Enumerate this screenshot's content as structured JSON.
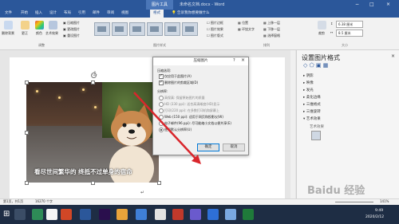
{
  "window": {
    "title": "未命名文档.docx - Word",
    "tools_tab": "图片工具",
    "controls": [
      "−",
      "□",
      "×"
    ]
  },
  "tabs": [
    "文件",
    "开始",
    "插入",
    "设计",
    "布局",
    "引用",
    "邮件",
    "审阅",
    "视图",
    "格式"
  ],
  "tell_me": "告诉我你想要做什么",
  "ribbon": {
    "adjust_buttons": [
      "删除背景",
      "更正",
      "颜色",
      "艺术效果"
    ],
    "adjust_small": [
      "压缩图片",
      "更改图片",
      "重设图片"
    ],
    "adjust_group": "调整",
    "styles_group": "图片样式",
    "style_options": [
      "图片边框",
      "图片效果",
      "图片版式"
    ],
    "arrange": [
      "位置",
      "环绕文字",
      "上移一层",
      "下移一层",
      "选择窗格"
    ],
    "arrange_group": "排列",
    "size_group": "大小",
    "crop": "裁剪",
    "height": "6.38 厘米",
    "width": "8.5 厘米"
  },
  "image": {
    "caption": "看尽世间繁华的 终抵不过单身的宿命"
  },
  "dialog": {
    "title": "压缩图片",
    "section1": "压缩选项:",
    "options": [
      {
        "label": "仅应用于此图片(A)",
        "checked": true
      },
      {
        "label": "删除图片的剪裁区域(D)",
        "checked": true
      }
    ],
    "section2": "分辨率:",
    "resolutions": [
      {
        "label": "高保真: 保留原始图片的质量",
        "enabled": false,
        "selected": false
      },
      {
        "label": "HD (330 ppi): 适合高清晰度(HD)显示",
        "enabled": false,
        "selected": false
      },
      {
        "label": "打印(220 ppi): 在多数打印机和屏幕上",
        "enabled": false,
        "selected": false
      },
      {
        "label": "Web (150 ppi): 适用于网页和投影仪(W)",
        "enabled": true,
        "selected": false
      },
      {
        "label": "电子邮件(96 ppi): 尽可能缩小文档以便共享(E)",
        "enabled": true,
        "selected": false
      },
      {
        "label": "使用默认分辨率(U)",
        "enabled": true,
        "selected": true
      }
    ],
    "ok": "确定",
    "cancel": "取消",
    "help": "?",
    "close": "×"
  },
  "pane": {
    "title": "设置图片格式",
    "sections": [
      "阴影",
      "映像",
      "发光",
      "柔化边缘",
      "三维格式",
      "三维旋转"
    ],
    "expanded": "艺术效果",
    "sub": "艺术效果"
  },
  "status": {
    "page": "第1页，共1页",
    "words": "16270 个字",
    "zoom": "141%"
  },
  "taskbar": {
    "time": "9:49",
    "date": "2020/2/12"
  },
  "watermark": "Baidu 经验",
  "colors": {
    "accent": "#2b579a",
    "arrow": "#d9262c"
  }
}
